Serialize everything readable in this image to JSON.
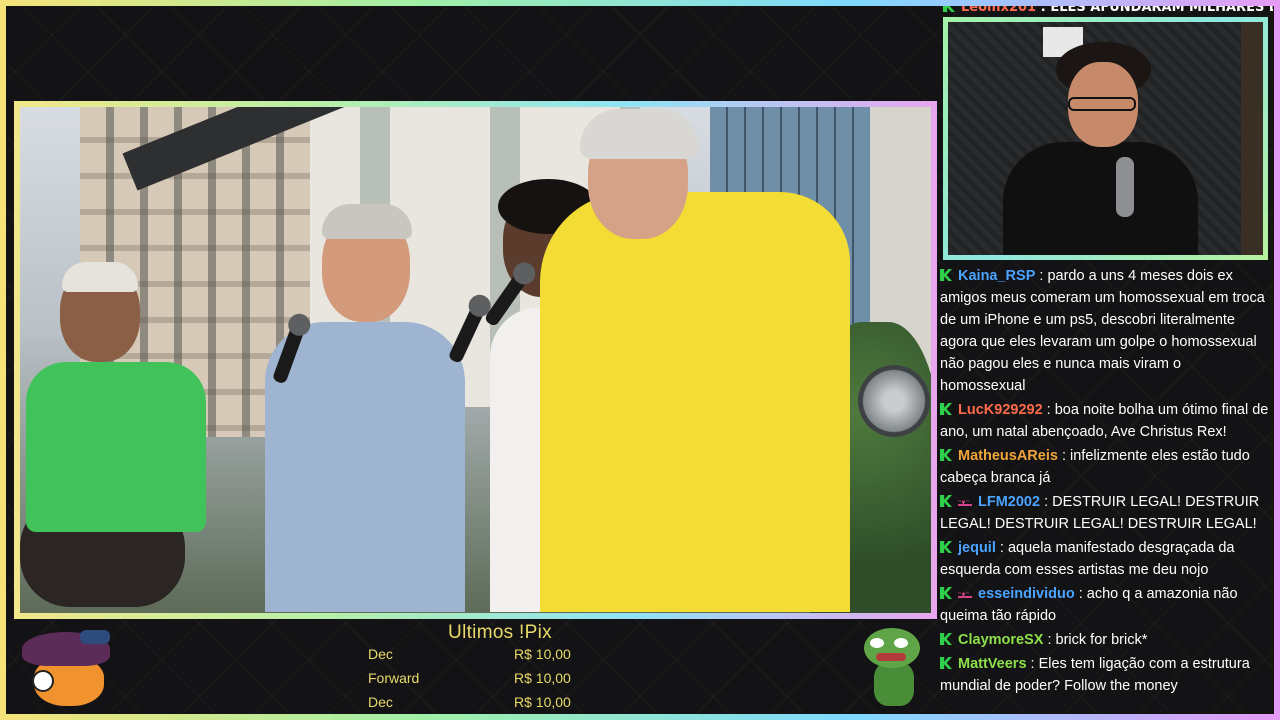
{
  "top_chat": {
    "name": "Leomx201",
    "text": ": ELES AFUNDARAM MILHARES DE"
  },
  "chat": {
    "messages": [
      {
        "badge": "green-k",
        "name": "Kaina_RSP",
        "color": "#4aa3ff",
        "text": ": pardo a uns 4 meses dois ex amigos meus comeram um homossexual em troca de um iPhone e um ps5, descobri literalmente agora que eles levaram um golpe o homossexual não pagou eles e nunca mais viram o homossexual"
      },
      {
        "badge": "green-k",
        "name": "LucK929292",
        "color": "#ff6b4a",
        "text": ": boa noite bolha um ótimo final de ano, um natal abençoado, Ave Christus Rex!"
      },
      {
        "badge": "green-k",
        "name": "MatheusAReis",
        "color": "#f0a53a",
        "text": ": infelizmente eles estão tudo cabeça branca já"
      },
      {
        "badge": "green-k+crown",
        "name": "LFM2002",
        "color": "#4aa3ff",
        "text": ": DESTRUIR LEGAL! DESTRUIR LEGAL! DESTRUIR LEGAL! DESTRUIR LEGAL!"
      },
      {
        "badge": "green-k",
        "name": "jequil",
        "color": "#4aa3ff",
        "text": ": aquela manifestado desgraçada da esquerda com esses artistas me deu nojo"
      },
      {
        "badge": "green-k+crown",
        "name": "esseindividuo",
        "color": "#4aa3ff",
        "text": ": acho q a amazonia não queima tão rápido"
      },
      {
        "badge": "green-k",
        "name": "ClaymoreSX",
        "color": "#8ee04a",
        "text": ": brick for brick*"
      },
      {
        "badge": "green-k",
        "name": "MattVeers",
        "color": "#8ee04a",
        "text": ": Eles tem ligação com a estrutura mundial de poder? Follow the money"
      }
    ]
  },
  "pix": {
    "title": "Ultimos !Pix",
    "entries": [
      {
        "name": "Dec",
        "value": "R$ 10,00"
      },
      {
        "name": "Forward",
        "value": "R$ 10,00"
      },
      {
        "name": "Dec",
        "value": "R$ 10,00"
      }
    ]
  },
  "colors": {
    "pix_text": "#e9d969",
    "badge_green": "#30d14a"
  }
}
